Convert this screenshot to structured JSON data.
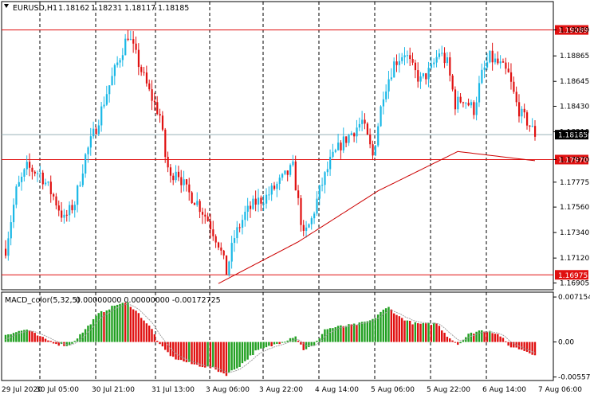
{
  "header": {
    "symbol": "EURUSD,H1",
    "open": "1.18162",
    "high": "1.18231",
    "low": "1.18117",
    "close": "1.18185"
  },
  "macd": {
    "title": "MACD_color(5,32,5)",
    "values_text": "0.00000000 0.00000000 -0.00172725",
    "scale_labels": [
      "0.0071549",
      "0.00",
      "-0.005571"
    ]
  },
  "colors": {
    "bull": "#1ab8e6",
    "bear": "#e01010",
    "level": "#e01010",
    "ma": "#cc0000",
    "hist_pos": "#22a022",
    "hist_neg": "#e01010",
    "signal": "#a0a0a0",
    "price_line": "#9ab0b8"
  },
  "chart_data": [
    {
      "type": "candlestick",
      "title": "EURUSD,H1",
      "y_ticks": [
        "1.19089",
        "1.18865",
        "1.18645",
        "1.18430",
        "1.18210",
        "1.17970",
        "1.17775",
        "1.17560",
        "1.17340",
        "1.17120",
        "1.16905",
        "1.16975"
      ],
      "ylim": [
        1.1686,
        1.1921
      ],
      "levels": [
        {
          "value": 1.19089,
          "label": "1.19089"
        },
        {
          "value": 1.1797,
          "label": "1.17970"
        },
        {
          "value": 1.16975,
          "label": "1.16975"
        }
      ],
      "current_price": {
        "value": 1.18185,
        "label": "1.18185"
      },
      "x_ticks": [
        "29 Jul 2020",
        "30 Jul 05:00",
        "30 Jul 21:00",
        "31 Jul 13:00",
        "3 Aug 06:00",
        "3 Aug 22:00",
        "4 Aug 14:00",
        "5 Aug 06:00",
        "5 Aug 22:00",
        "6 Aug 14:00",
        "7 Aug 06:00"
      ],
      "anchors": [
        [
          0,
          1.172
        ],
        [
          4,
          1.177
        ],
        [
          8,
          1.179
        ],
        [
          13,
          1.1785
        ],
        [
          18,
          1.1765
        ],
        [
          22,
          1.1745
        ],
        [
          26,
          1.176
        ],
        [
          30,
          1.18
        ],
        [
          34,
          1.1825
        ],
        [
          38,
          1.1855
        ],
        [
          42,
          1.188
        ],
        [
          46,
          1.1905
        ],
        [
          50,
          1.188
        ],
        [
          54,
          1.1855
        ],
        [
          58,
          1.1835
        ],
        [
          60,
          1.18
        ],
        [
          62,
          1.178
        ],
        [
          64,
          1.179
        ],
        [
          68,
          1.177
        ],
        [
          72,
          1.176
        ],
        [
          76,
          1.1745
        ],
        [
          80,
          1.1725
        ],
        [
          83,
          1.17
        ],
        [
          86,
          1.173
        ],
        [
          90,
          1.175
        ],
        [
          94,
          1.176
        ],
        [
          98,
          1.1765
        ],
        [
          102,
          1.1775
        ],
        [
          106,
          1.1785
        ],
        [
          108,
          1.179
        ],
        [
          110,
          1.176
        ],
        [
          112,
          1.173
        ],
        [
          115,
          1.1745
        ],
        [
          118,
          1.177
        ],
        [
          122,
          1.1795
        ],
        [
          126,
          1.181
        ],
        [
          130,
          1.182
        ],
        [
          134,
          1.183
        ],
        [
          138,
          1.18
        ],
        [
          142,
          1.1855
        ],
        [
          146,
          1.188
        ],
        [
          150,
          1.189
        ],
        [
          153,
          1.1875
        ],
        [
          156,
          1.1865
        ],
        [
          160,
          1.1875
        ],
        [
          163,
          1.189
        ],
        [
          166,
          1.188
        ],
        [
          169,
          1.1845
        ],
        [
          172,
          1.185
        ],
        [
          176,
          1.184
        ],
        [
          179,
          1.187
        ],
        [
          182,
          1.1885
        ],
        [
          186,
          1.1878
        ],
        [
          189,
          1.187
        ],
        [
          192,
          1.1845
        ],
        [
          194,
          1.1835
        ],
        [
          196,
          1.183
        ],
        [
          199,
          1.1819
        ]
      ],
      "ma": [
        [
          80,
          1.169
        ],
        [
          110,
          1.1726
        ],
        [
          140,
          1.177
        ],
        [
          170,
          1.1804
        ],
        [
          199,
          1.1796
        ]
      ],
      "macd_histogram_anchors": [
        [
          0,
          0.0012
        ],
        [
          8,
          0.002
        ],
        [
          13,
          0.0008
        ],
        [
          20,
          -0.0004
        ],
        [
          24,
          -0.0006
        ],
        [
          30,
          0.002
        ],
        [
          35,
          0.0045
        ],
        [
          42,
          0.006
        ],
        [
          46,
          0.0062
        ],
        [
          50,
          0.0045
        ],
        [
          55,
          0.002
        ],
        [
          58,
          -0.0005
        ],
        [
          63,
          -0.0025
        ],
        [
          70,
          -0.0035
        ],
        [
          78,
          -0.0042
        ],
        [
          83,
          -0.0052
        ],
        [
          88,
          -0.0038
        ],
        [
          94,
          -0.0015
        ],
        [
          100,
          -0.0006
        ],
        [
          105,
          0.0002
        ],
        [
          109,
          0.001
        ],
        [
          112,
          -0.0012
        ],
        [
          116,
          -0.0006
        ],
        [
          120,
          0.002
        ],
        [
          126,
          0.0025
        ],
        [
          132,
          0.0028
        ],
        [
          138,
          0.0035
        ],
        [
          141,
          0.0048
        ],
        [
          144,
          0.0055
        ],
        [
          148,
          0.004
        ],
        [
          153,
          0.003
        ],
        [
          158,
          0.0028
        ],
        [
          162,
          0.003
        ],
        [
          166,
          0.001
        ],
        [
          170,
          -0.0004
        ],
        [
          174,
          0.0012
        ],
        [
          178,
          0.0018
        ],
        [
          182,
          0.0018
        ],
        [
          186,
          0.001
        ],
        [
          189,
          -0.0006
        ],
        [
          194,
          -0.0012
        ],
        [
          199,
          -0.002
        ]
      ]
    }
  ]
}
